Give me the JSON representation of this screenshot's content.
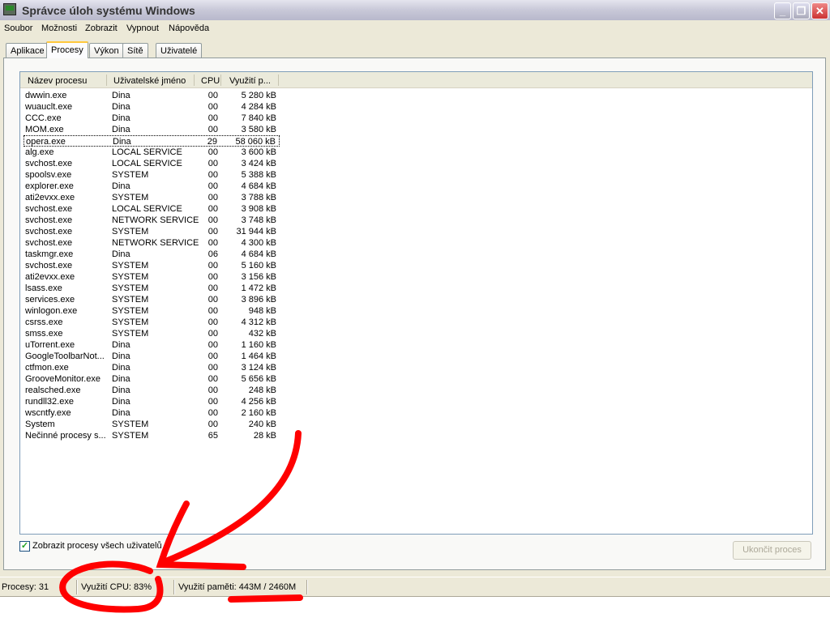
{
  "window": {
    "title": "Správce úloh systému Windows"
  },
  "menu": [
    "Soubor",
    "Možnosti",
    "Zobrazit",
    "Vypnout",
    "Nápověda"
  ],
  "tabs": [
    "Aplikace",
    "Procesy",
    "Výkon",
    "Sítě",
    "Uživatelé"
  ],
  "columns": [
    "Název procesu",
    "Uživatelské jméno",
    "CPU",
    "Využití p..."
  ],
  "rows": [
    [
      "dwwin.exe",
      "Dina",
      "00",
      "5 280 kB"
    ],
    [
      "wuauclt.exe",
      "Dina",
      "00",
      "4 284 kB"
    ],
    [
      "CCC.exe",
      "Dina",
      "00",
      "7 840 kB"
    ],
    [
      "MOM.exe",
      "Dina",
      "00",
      "3 580 kB"
    ],
    [
      "opera.exe",
      "Dina",
      "29",
      "58 060 kB"
    ],
    [
      "alg.exe",
      "LOCAL SERVICE",
      "00",
      "3 600 kB"
    ],
    [
      "svchost.exe",
      "LOCAL SERVICE",
      "00",
      "3 424 kB"
    ],
    [
      "spoolsv.exe",
      "SYSTEM",
      "00",
      "5 388 kB"
    ],
    [
      "explorer.exe",
      "Dina",
      "00",
      "4 684 kB"
    ],
    [
      "ati2evxx.exe",
      "SYSTEM",
      "00",
      "3 788 kB"
    ],
    [
      "svchost.exe",
      "LOCAL SERVICE",
      "00",
      "3 908 kB"
    ],
    [
      "svchost.exe",
      "NETWORK SERVICE",
      "00",
      "3 748 kB"
    ],
    [
      "svchost.exe",
      "SYSTEM",
      "00",
      "31 944 kB"
    ],
    [
      "svchost.exe",
      "NETWORK SERVICE",
      "00",
      "4 300 kB"
    ],
    [
      "taskmgr.exe",
      "Dina",
      "06",
      "4 684 kB"
    ],
    [
      "svchost.exe",
      "SYSTEM",
      "00",
      "5 160 kB"
    ],
    [
      "ati2evxx.exe",
      "SYSTEM",
      "00",
      "3 156 kB"
    ],
    [
      "lsass.exe",
      "SYSTEM",
      "00",
      "1 472 kB"
    ],
    [
      "services.exe",
      "SYSTEM",
      "00",
      "3 896 kB"
    ],
    [
      "winlogon.exe",
      "SYSTEM",
      "00",
      "948 kB"
    ],
    [
      "csrss.exe",
      "SYSTEM",
      "00",
      "4 312 kB"
    ],
    [
      "smss.exe",
      "SYSTEM",
      "00",
      "432 kB"
    ],
    [
      "uTorrent.exe",
      "Dina",
      "00",
      "1 160 kB"
    ],
    [
      "GoogleToolbarNot...",
      "Dina",
      "00",
      "1 464 kB"
    ],
    [
      "ctfmon.exe",
      "Dina",
      "00",
      "3 124 kB"
    ],
    [
      "GrooveMonitor.exe",
      "Dina",
      "00",
      "5 656 kB"
    ],
    [
      "realsched.exe",
      "Dina",
      "00",
      "248 kB"
    ],
    [
      "rundll32.exe",
      "Dina",
      "00",
      "4 256 kB"
    ],
    [
      "wscntfy.exe",
      "Dina",
      "00",
      "2 160 kB"
    ],
    [
      "System",
      "SYSTEM",
      "00",
      "240 kB"
    ],
    [
      "Nečinné procesy s...",
      "SYSTEM",
      "65",
      "28 kB"
    ]
  ],
  "show_all_label": "Zobrazit procesy všech uživatelů",
  "show_all_checked": true,
  "end_process_label": "Ukončit proces",
  "status": {
    "processes": "Procesy: 31",
    "cpu": "Využití CPU: 83%",
    "memory": "Využití paměti: 443M / 2460M"
  },
  "annotation_color": "#ff0000"
}
